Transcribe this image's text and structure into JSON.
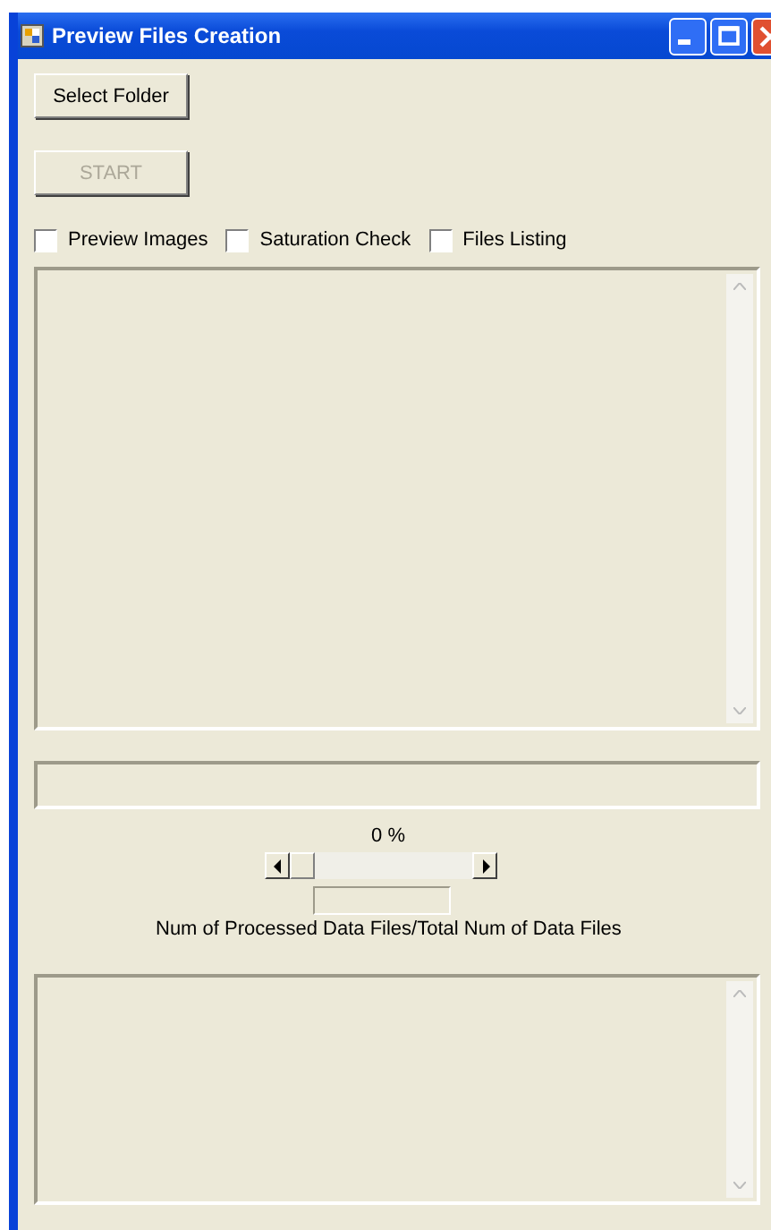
{
  "window": {
    "title": "Preview Files Creation"
  },
  "buttons": [
    {
      "label": "Select Folder",
      "disabled": false
    },
    {
      "label": "START",
      "disabled": true
    }
  ],
  "options": [
    {
      "label": "Preview Images",
      "checked": false
    },
    {
      "label": "Saturation Check",
      "checked": false
    },
    {
      "label": "Files Listing",
      "checked": false
    }
  ],
  "progress": {
    "reading": "0 %",
    "caption": "Num of Processed Data Files/Total Num of Data Files"
  }
}
